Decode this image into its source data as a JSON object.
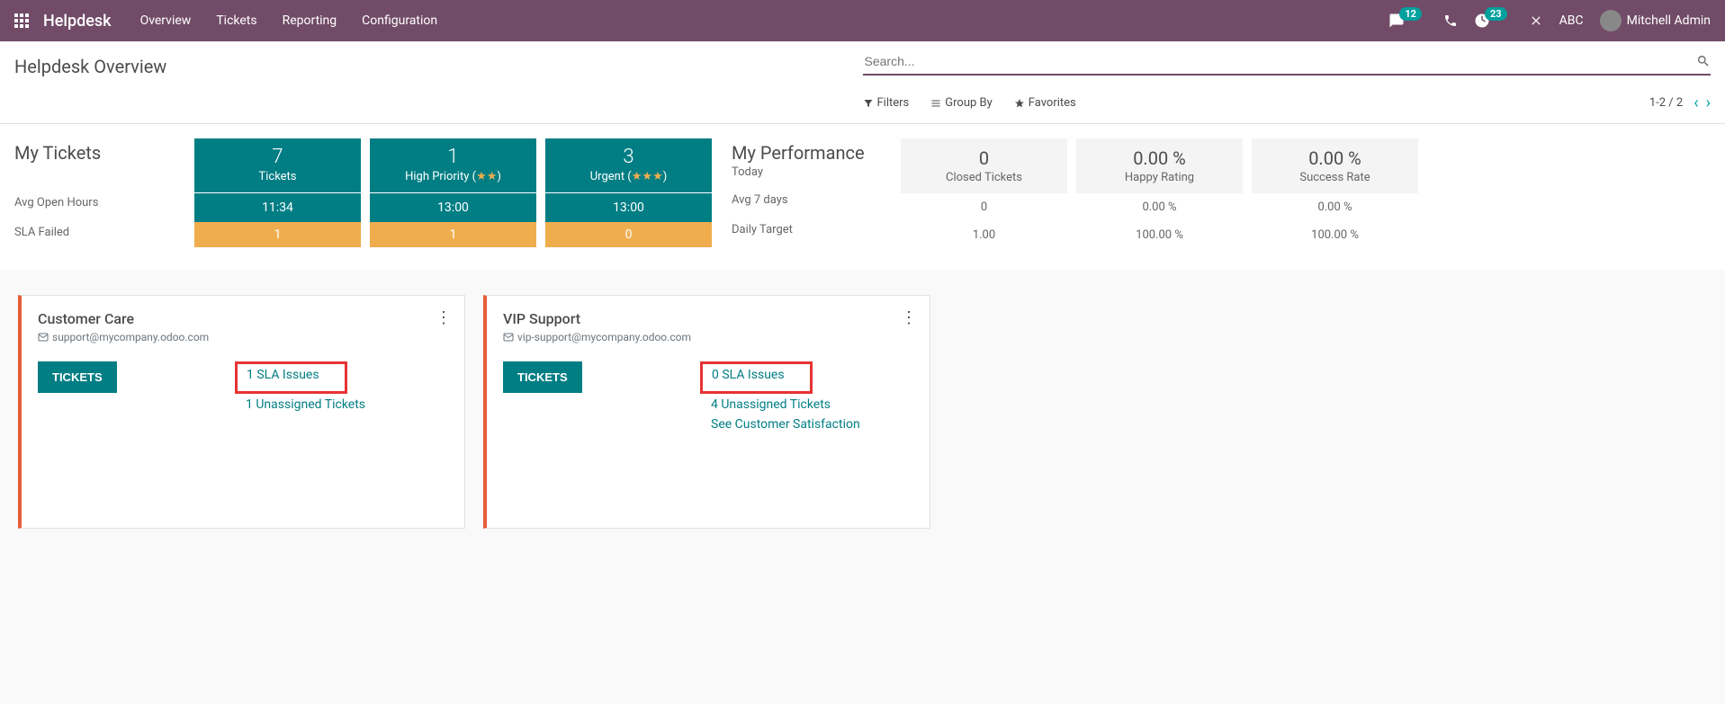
{
  "navbar": {
    "brand": "Helpdesk",
    "links": [
      "Overview",
      "Tickets",
      "Reporting",
      "Configuration"
    ],
    "msg_badge": "12",
    "activity_badge": "23",
    "company": "ABC",
    "user": "Mitchell Admin"
  },
  "page": {
    "title": "Helpdesk Overview",
    "search_placeholder": "Search...",
    "filters": "Filters",
    "group_by": "Group By",
    "favorites": "Favorites",
    "pager": "1-2 / 2"
  },
  "my_tickets": {
    "heading": "My Tickets",
    "row_avg": "Avg Open Hours",
    "row_sla": "SLA Failed",
    "cols": [
      {
        "num": "7",
        "label": "Tickets",
        "stars": 0,
        "mid": "11:34",
        "foot": "1"
      },
      {
        "num": "1",
        "label": "High Priority",
        "stars": 2,
        "mid": "13:00",
        "foot": "1"
      },
      {
        "num": "3",
        "label": "Urgent",
        "stars": 3,
        "mid": "13:00",
        "foot": "0"
      }
    ]
  },
  "performance": {
    "heading": "My Performance",
    "sub": "Today",
    "row_avg": "Avg 7 days",
    "row_target": "Daily Target",
    "cols": [
      {
        "num": "0",
        "label": "Closed Tickets",
        "avg": "0",
        "target": "1.00"
      },
      {
        "num": "0.00 %",
        "label": "Happy Rating",
        "avg": "0.00 %",
        "target": "100.00 %"
      },
      {
        "num": "0.00 %",
        "label": "Success Rate",
        "avg": "0.00 %",
        "target": "100.00 %"
      }
    ]
  },
  "teams": [
    {
      "name": "Customer Care",
      "email": "support@mycompany.odoo.com",
      "button": "TICKETS",
      "sla": "1 SLA Issues",
      "links": [
        "1 Unassigned Tickets"
      ]
    },
    {
      "name": "VIP Support",
      "email": "vip-support@mycompany.odoo.com",
      "button": "TICKETS",
      "sla": "0 SLA Issues",
      "links": [
        "4 Unassigned Tickets",
        "See Customer Satisfaction"
      ]
    }
  ]
}
